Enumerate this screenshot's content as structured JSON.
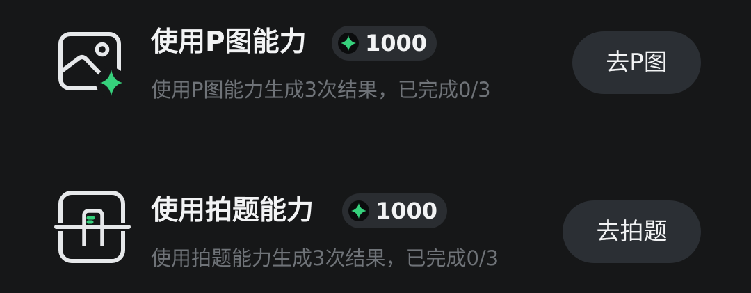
{
  "tasks": [
    {
      "title": "使用P图能力",
      "reward": "1000",
      "description": "使用P图能力生成3次结果，已完成0/3",
      "button_label": "去P图",
      "icon": "image-edit-icon"
    },
    {
      "title": "使用拍题能力",
      "reward": "1000",
      "description": "使用拍题能力生成3次结果，已完成0/3",
      "button_label": "去拍题",
      "icon": "scan-question-icon"
    }
  ],
  "reward_icon": "sparkle-coin-icon",
  "colors": {
    "background": "#161718",
    "accent_green": "#36d17c",
    "badge_bg": "#2a2d31",
    "button_bg": "#2b2f34",
    "title_text": "#f2f3f4",
    "desc_text": "#6f7378"
  }
}
